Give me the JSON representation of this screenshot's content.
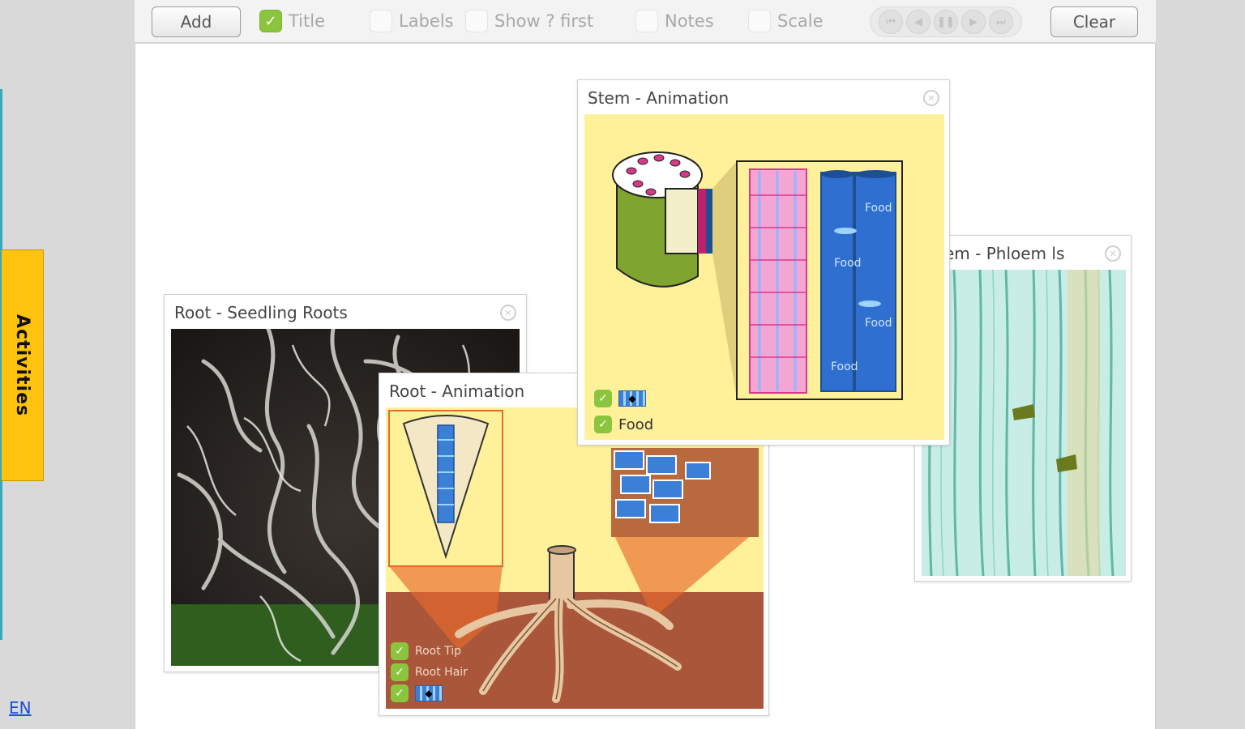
{
  "side": {
    "activities_label": "Activities",
    "language": "EN"
  },
  "toolbar": {
    "add_label": "Add",
    "clear_label": "Clear",
    "options": [
      {
        "label": "Title",
        "checked": true
      },
      {
        "label": "Labels",
        "checked": false
      },
      {
        "label": "Show ? first",
        "checked": false
      },
      {
        "label": "Notes",
        "checked": false
      },
      {
        "label": "Scale",
        "checked": false
      }
    ],
    "player_icons": [
      "skip-back-icon",
      "step-back-icon",
      "pause-icon",
      "step-forward-icon",
      "skip-forward-icon"
    ]
  },
  "panels": {
    "seedling": {
      "title": "Root - Seedling Roots"
    },
    "root_anim": {
      "title": "Root - Animation",
      "checks": [
        "Root Tip",
        "Root Hair",
        ""
      ]
    },
    "stem_anim": {
      "title": "Stem - Animation",
      "checks": [
        "",
        "Food"
      ],
      "food_labels": [
        "Food",
        "Food",
        "Food",
        "Food"
      ]
    },
    "phloem": {
      "title": "em - Phloem ls"
    }
  },
  "colors": {
    "accent_yellow": "#ffc20e",
    "check_green": "#8bc53f",
    "panel_bg_yellow": "#fff19a",
    "soil_brown": "#a9563a"
  }
}
